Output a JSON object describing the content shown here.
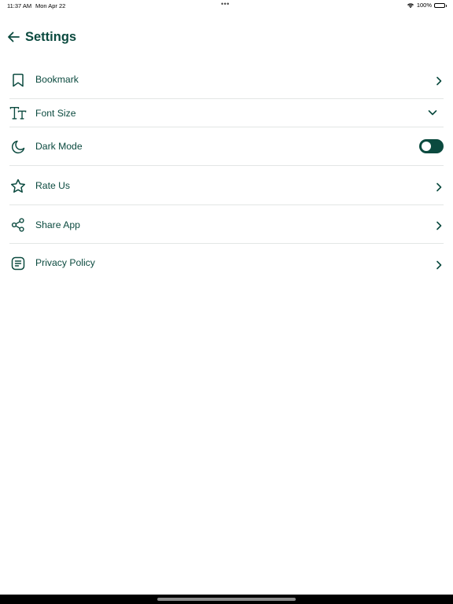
{
  "status_bar": {
    "time": "11:37 AM",
    "date": "Mon Apr 22",
    "dots": "•••",
    "battery": "100%",
    "battery_level": 1.0
  },
  "header": {
    "title": "Settings",
    "back_icon": "arrow-left-icon"
  },
  "colors": {
    "accent": "#0b4a3f",
    "divider": "#e3e6e5",
    "background": "#ffffff"
  },
  "settings": {
    "items": [
      {
        "label": "Bookmark",
        "icon": "bookmark-icon",
        "trailing": "chevron-right-icon"
      },
      {
        "label": "Font Size",
        "icon": "font-size-icon",
        "trailing": "chevron-down-icon"
      },
      {
        "label": "Dark Mode",
        "icon": "moon-icon",
        "trailing": "toggle",
        "toggle_on": true
      },
      {
        "label": "Rate Us",
        "icon": "star-icon",
        "trailing": "chevron-right-icon"
      },
      {
        "label": "Share App",
        "icon": "share-icon",
        "trailing": "chevron-right-icon"
      },
      {
        "label": "Privacy Policy",
        "icon": "document-icon",
        "trailing": "chevron-right-icon"
      }
    ]
  }
}
